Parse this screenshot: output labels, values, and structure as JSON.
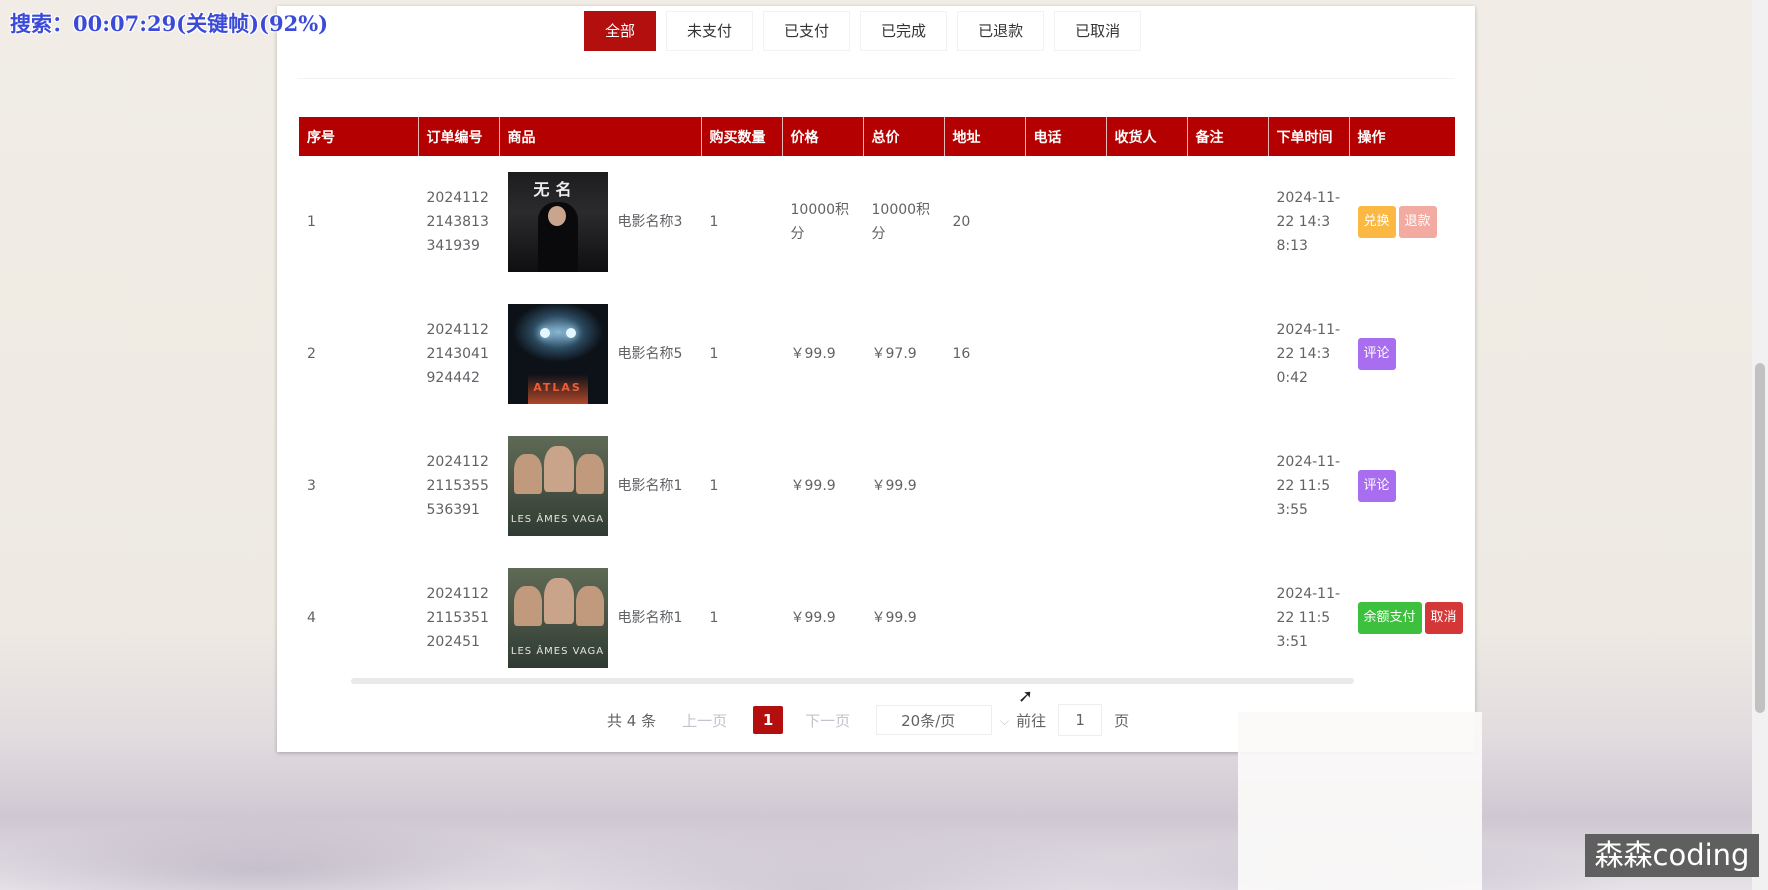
{
  "overlay": {
    "timer_text": "搜索：00:07:29(关键帧)(92%)"
  },
  "tabs": [
    {
      "label": "全部",
      "active": true
    },
    {
      "label": "未支付",
      "active": false
    },
    {
      "label": "已支付",
      "active": false
    },
    {
      "label": "已完成",
      "active": false
    },
    {
      "label": "已退款",
      "active": false
    },
    {
      "label": "已取消",
      "active": false
    }
  ],
  "table": {
    "headers": [
      "序号",
      "订单编号",
      "商品",
      "购买数量",
      "价格",
      "总价",
      "地址",
      "电话",
      "收货人",
      "备注",
      "下单时间",
      "操作"
    ],
    "rows": [
      {
        "index": "1",
        "order_no": "20241122143813341939",
        "movie": "电影名称3",
        "qty": "1",
        "price": "10000积分",
        "total": "10000积分",
        "address": "20",
        "phone": "",
        "receiver": "",
        "remark": "",
        "time": "2024-11-22 14:38:13",
        "actions": [
          "兑换",
          "退款"
        ]
      },
      {
        "index": "2",
        "order_no": "20241122143041924442",
        "movie": "电影名称5",
        "qty": "1",
        "price": "￥99.9",
        "total": "￥97.9",
        "address": "16",
        "phone": "",
        "receiver": "",
        "remark": "",
        "time": "2024-11-22 14:30:42",
        "actions": [
          "评论"
        ]
      },
      {
        "index": "3",
        "order_no": "20241122115355536391",
        "movie": "电影名称1",
        "qty": "1",
        "price": "￥99.9",
        "total": "￥99.9",
        "address": "",
        "phone": "",
        "receiver": "",
        "remark": "",
        "time": "2024-11-22 11:53:55",
        "actions": [
          "评论"
        ]
      },
      {
        "index": "4",
        "order_no": "20241122115351202451",
        "movie": "电影名称1",
        "qty": "1",
        "price": "￥99.9",
        "total": "￥99.9",
        "address": "",
        "phone": "",
        "receiver": "",
        "remark": "",
        "time": "2024-11-22 11:53:51",
        "actions": [
          "余额支付",
          "取消"
        ]
      }
    ]
  },
  "posters": {
    "p1_title": "无名",
    "p2_title": "ATLAS",
    "p3_title": "LES ÂMES VAGABONDES"
  },
  "pagination": {
    "total": "共 4 条",
    "prev": "上一页",
    "current": "1",
    "next": "下一页",
    "page_size": "20条/页",
    "goto_label": "前往",
    "goto_value": "1",
    "page_suffix": "页"
  },
  "watermark": "森森coding",
  "colors": {
    "accent": "#b30f0f",
    "header_bg": "#b40000"
  }
}
